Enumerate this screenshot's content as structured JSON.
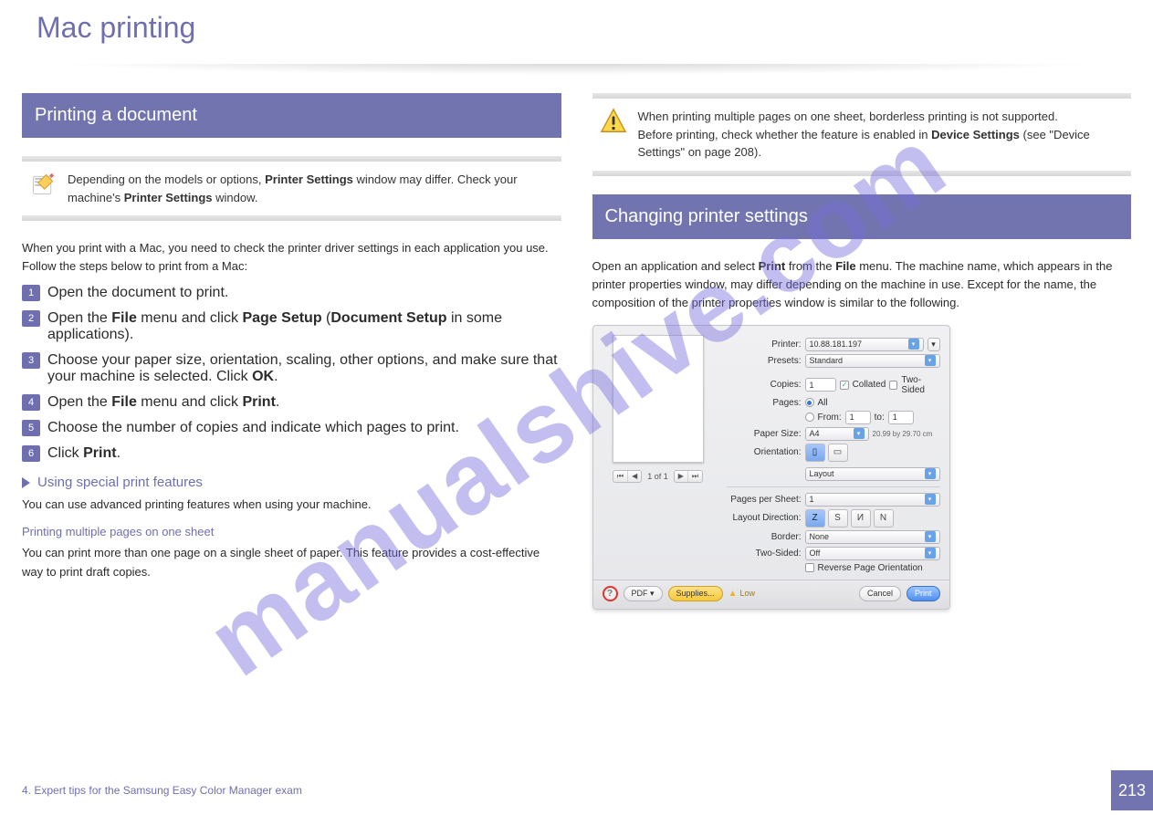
{
  "watermark": "manualshive.com",
  "header": {
    "title": "Mac printing"
  },
  "left": {
    "section_title": "Printing a document",
    "note": {
      "before": "Depending on the models or options, ",
      "bold1": "Printer Settings",
      "after1": " window may differ. Check your machine's ",
      "bold2": "Printer Settings",
      "after2": " window."
    },
    "intro": "When you print with a Mac, you need to check the printer driver settings in each application you use. Follow the steps below to print from a Mac:",
    "steps": [
      {
        "text": "Open the document to print."
      },
      {
        "pre": "Open the ",
        "b1": "File",
        "mid": " menu and click ",
        "b2": "Page Setup",
        "post": " (",
        "b3": "Document Setup",
        "post2": " in some applications)."
      },
      {
        "pre": "Choose your paper size, orientation, scaling, other options, and make sure that your machine is selected. Click ",
        "b1": "OK",
        "post": "."
      },
      {
        "pre": "Open the ",
        "b1": "File",
        "mid": " menu and click ",
        "b2": "Print",
        "post": "."
      },
      {
        "text": "Choose the number of copies and indicate which pages to print."
      },
      {
        "pre": "Click ",
        "b1": "Print",
        "post": "."
      }
    ],
    "sub1": {
      "title": "Using special print features",
      "text": "You can use advanced printing features when using your machine."
    },
    "sub2": {
      "title": "Printing multiple pages on one sheet",
      "text": "You can print more than one page on a single sheet of paper. This feature provides a cost-effective way to print draft copies."
    }
  },
  "right": {
    "caution_line1": "When printing multiple pages on one sheet, borderless printing is not supported.",
    "caution_line2_pre": "Before printing, check whether the feature is enabled in ",
    "caution_line2_b": "Device Settings",
    "caution_line2_mid": " (see \"Device Settings\" on page 208).",
    "section_title": "Changing printer settings",
    "body_p1_pre": "Open an application and select ",
    "body_p1_b1": "Print",
    "body_p1_mid": " from the ",
    "body_p1_b2": "File",
    "body_p1_post": " menu. The machine name, which appears in the printer properties window, may differ depending on the machine in use. Except for the name, the composition of the printer properties window is similar to the following.",
    "dialog": {
      "printer_label": "Printer:",
      "printer_value": "10.88.181.197",
      "presets_label": "Presets:",
      "presets_value": "Standard",
      "copies_label": "Copies:",
      "copies_value": "1",
      "collated": "Collated",
      "twosided": "Two-Sided",
      "pages_label": "Pages:",
      "pages_all": "All",
      "pages_from": "From:",
      "from_val": "1",
      "to_label": "to:",
      "to_val": "1",
      "papersize_label": "Paper Size:",
      "papersize_value": "A4",
      "papersize_dim": "20.99 by 29.70 cm",
      "orientation_label": "Orientation:",
      "panel_value": "Layout",
      "pps_label": "Pages per Sheet:",
      "pps_value": "1",
      "layoutdir_label": "Layout Direction:",
      "border_label": "Border:",
      "border_value": "None",
      "twosided2_label": "Two-Sided:",
      "twosided2_value": "Off",
      "reverse": "Reverse Page Orientation",
      "preview_page": "1 of 1",
      "pdf": "PDF ▾",
      "supplies": "Supplies...",
      "low": "Low",
      "cancel": "Cancel",
      "print": "Print"
    }
  },
  "footer": {
    "breadcrumb": "4. Expert tips for the Samsung Easy Color Manager exam",
    "page": "213"
  }
}
